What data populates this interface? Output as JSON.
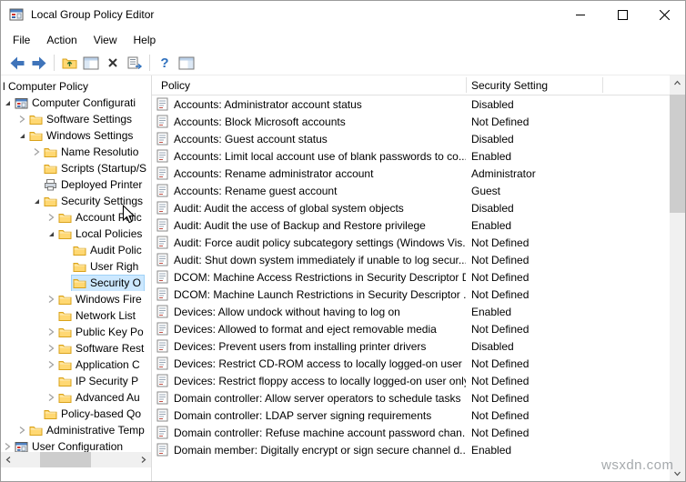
{
  "window": {
    "title": "Local Group Policy Editor"
  },
  "menu_items": [
    "File",
    "Action",
    "View",
    "Help"
  ],
  "toolbar_icons": [
    "back",
    "forward",
    "separator",
    "up-one-level",
    "show-console-tree",
    "delete",
    "export-list",
    "separator",
    "help",
    "show-action-pane"
  ],
  "tree": {
    "items": [
      {
        "label": "l Computer Policy",
        "level": 0,
        "chevron": "none",
        "icon": "none",
        "selected": false
      },
      {
        "label": "Computer Configurati",
        "level": 1,
        "chevron": "expanded",
        "icon": "console",
        "selected": false
      },
      {
        "label": "Software Settings",
        "level": 2,
        "chevron": "collapsed",
        "icon": "folder",
        "selected": false
      },
      {
        "label": "Windows Settings",
        "level": 2,
        "chevron": "expanded",
        "icon": "folder",
        "selected": false
      },
      {
        "label": "Name Resolutio",
        "level": 3,
        "chevron": "collapsed",
        "icon": "folder",
        "selected": false
      },
      {
        "label": "Scripts (Startup/S",
        "level": 3,
        "chevron": "none",
        "icon": "folder",
        "selected": false
      },
      {
        "label": "Deployed Printer",
        "level": 3,
        "chevron": "none",
        "icon": "printer",
        "selected": false
      },
      {
        "label": "Security Settings",
        "level": 3,
        "chevron": "expanded",
        "icon": "folder",
        "selected": false
      },
      {
        "label": "Account Polic",
        "level": 4,
        "chevron": "collapsed",
        "icon": "folder",
        "selected": false
      },
      {
        "label": "Local Policies",
        "level": 4,
        "chevron": "expanded",
        "icon": "folder",
        "selected": false
      },
      {
        "label": "Audit Polic",
        "level": 5,
        "chevron": "none",
        "icon": "folder",
        "selected": false
      },
      {
        "label": "User Righ",
        "level": 5,
        "chevron": "none",
        "icon": "folder",
        "selected": false
      },
      {
        "label": "Security O",
        "level": 5,
        "chevron": "none",
        "icon": "folder",
        "selected": true
      },
      {
        "label": "Windows Fire",
        "level": 4,
        "chevron": "collapsed",
        "icon": "folder",
        "selected": false
      },
      {
        "label": "Network List",
        "level": 4,
        "chevron": "none",
        "icon": "folder",
        "selected": false
      },
      {
        "label": "Public Key Po",
        "level": 4,
        "chevron": "collapsed",
        "icon": "folder",
        "selected": false
      },
      {
        "label": "Software Rest",
        "level": 4,
        "chevron": "collapsed",
        "icon": "folder",
        "selected": false
      },
      {
        "label": "Application C",
        "level": 4,
        "chevron": "collapsed",
        "icon": "folder",
        "selected": false
      },
      {
        "label": "IP Security P",
        "level": 4,
        "chevron": "none",
        "icon": "folder",
        "selected": false
      },
      {
        "label": "Advanced Au",
        "level": 4,
        "chevron": "collapsed",
        "icon": "folder",
        "selected": false
      },
      {
        "label": "Policy-based Qo",
        "level": 3,
        "chevron": "none",
        "icon": "folder",
        "selected": false
      },
      {
        "label": "Administrative Temp",
        "level": 2,
        "chevron": "collapsed",
        "icon": "folder",
        "selected": false
      },
      {
        "label": "User Configuration",
        "level": 1,
        "chevron": "collapsed",
        "icon": "console",
        "selected": false
      }
    ]
  },
  "list": {
    "columns": [
      "Policy",
      "Security Setting"
    ],
    "rows": [
      {
        "policy": "Accounts: Administrator account status",
        "setting": "Disabled"
      },
      {
        "policy": "Accounts: Block Microsoft accounts",
        "setting": "Not Defined"
      },
      {
        "policy": "Accounts: Guest account status",
        "setting": "Disabled"
      },
      {
        "policy": "Accounts: Limit local account use of blank passwords to co...",
        "setting": "Enabled"
      },
      {
        "policy": "Accounts: Rename administrator account",
        "setting": "Administrator"
      },
      {
        "policy": "Accounts: Rename guest account",
        "setting": "Guest"
      },
      {
        "policy": "Audit: Audit the access of global system objects",
        "setting": "Disabled"
      },
      {
        "policy": "Audit: Audit the use of Backup and Restore privilege",
        "setting": "Enabled"
      },
      {
        "policy": "Audit: Force audit policy subcategory settings (Windows Vis...",
        "setting": "Not Defined"
      },
      {
        "policy": "Audit: Shut down system immediately if unable to log secur...",
        "setting": "Not Defined"
      },
      {
        "policy": "DCOM: Machine Access Restrictions in Security Descriptor D...",
        "setting": "Not Defined"
      },
      {
        "policy": "DCOM: Machine Launch Restrictions in Security Descriptor ...",
        "setting": "Not Defined"
      },
      {
        "policy": "Devices: Allow undock without having to log on",
        "setting": "Enabled"
      },
      {
        "policy": "Devices: Allowed to format and eject removable media",
        "setting": "Not Defined"
      },
      {
        "policy": "Devices: Prevent users from installing printer drivers",
        "setting": "Disabled"
      },
      {
        "policy": "Devices: Restrict CD-ROM access to locally logged-on user ...",
        "setting": "Not Defined"
      },
      {
        "policy": "Devices: Restrict floppy access to locally logged-on user only",
        "setting": "Not Defined"
      },
      {
        "policy": "Domain controller: Allow server operators to schedule tasks",
        "setting": "Not Defined"
      },
      {
        "policy": "Domain controller: LDAP server signing requirements",
        "setting": "Not Defined"
      },
      {
        "policy": "Domain controller: Refuse machine account password chan...",
        "setting": "Not Defined"
      },
      {
        "policy": "Domain member: Digitally encrypt or sign secure channel d...",
        "setting": "Enabled"
      }
    ]
  },
  "watermark": "wsxdn.com"
}
